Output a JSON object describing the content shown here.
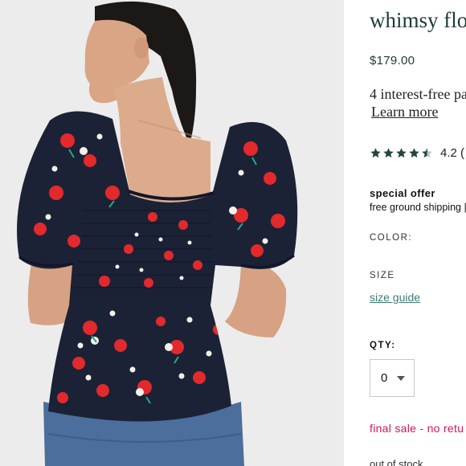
{
  "product": {
    "title": "whimsy flo",
    "price": "$179.00",
    "installments_text": "4 interest-free pa",
    "learn_more": "Learn more",
    "rating": {
      "value": 4.5,
      "max": 5,
      "label": "4.2 ("
    },
    "special_offer": {
      "heading": "special offer",
      "body": "free ground shipping ",
      "link": "|"
    },
    "color_label": "COLOR:",
    "size_label": "SIZE",
    "size_guide": "size guide",
    "qty_label": "QTY:",
    "qty_value": "0",
    "final_sale": "final sale - no retu",
    "stock_status": "out of stock"
  },
  "colors": {
    "brand_green": "#1d3b34",
    "link_teal": "#3a7d74",
    "sale_pink": "#d4145a",
    "star": "#24463e",
    "blouse_navy": "#1b2235",
    "print_red": "#e2292c"
  },
  "icons": [
    "star-icon",
    "caret-down-icon"
  ]
}
